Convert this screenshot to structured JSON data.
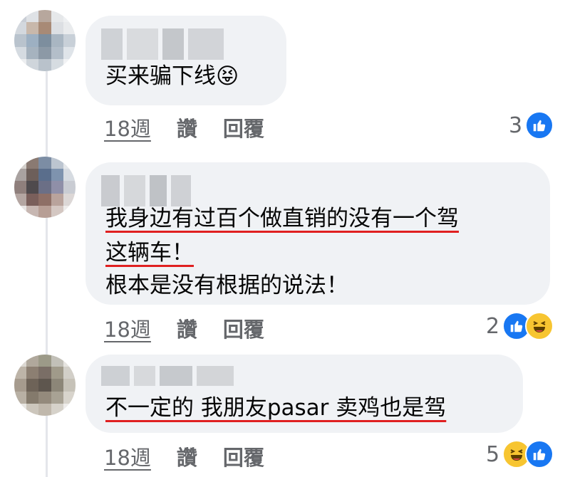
{
  "comments": [
    {
      "text_lines": [
        "买来骗下线😝"
      ],
      "time": "18週",
      "like_label": "讚",
      "reply_label": "回覆",
      "reaction_count": "3",
      "reactions": [
        "like-icon"
      ]
    },
    {
      "text_lines": [
        "我身边有过百个做直销的没有一个驾",
        "这辆车！",
        "根本是没有根据的说法！"
      ],
      "time": "18週",
      "like_label": "讚",
      "reply_label": "回覆",
      "reaction_count": "2",
      "reactions": [
        "like-icon",
        "haha-icon"
      ]
    },
    {
      "text_lines": [
        "不一定的 我朋友pasar 卖鸡也是驾"
      ],
      "time": "18週",
      "like_label": "讚",
      "reply_label": "回覆",
      "reaction_count": "5",
      "reactions": [
        "haha-icon",
        "like-icon"
      ]
    }
  ],
  "colors": {
    "bubble": "#f0f2f5",
    "meta_text": "#65676b",
    "like_blue": "#1877f2",
    "haha_yellow": "#f7c531",
    "underline_red": "#e02020"
  }
}
